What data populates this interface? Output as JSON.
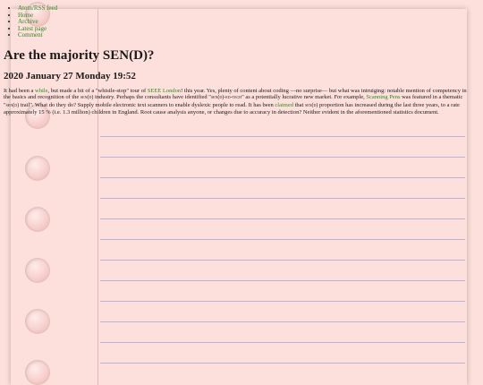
{
  "nav": [
    {
      "label": "Atom/RSS feed"
    },
    {
      "label": "Home"
    },
    {
      "label": "Archive"
    },
    {
      "label": "Latest page"
    },
    {
      "label": "Comment"
    }
  ],
  "post": {
    "title": "Are the majority SEN(D)?",
    "date": "2020 January 27 Monday 19:52",
    "p1": "It had been a ",
    "link_while": "while",
    "p2": ", but made a bit of a \"whistle-stop\" tour of ",
    "link_london": "SEEE London",
    "p3": "! this year. Yes, plenty of content about coding —no surprise— but what was intruiging: notable mention of competency in the basics and recognition of the ",
    "sc1": "sen(d)",
    "p4": " industry. Perhaps the consultants have identified \"",
    "sc2": "sen(d)-ed-tech",
    "p5": "\" as a potentially lucrative new market. For example, ",
    "link_pens": "Scanning Pens",
    "p6": " was featured in a thematic \"",
    "sc3": "sen(d)",
    "p7": " trail\". What do they do? Supply mobile electronic text scanners to enable dyslexic people to read. It has been ",
    "link_claimed": "claimed",
    "p8": " that ",
    "sc4": "sen(d)",
    "p9": " proportion has increased during the last three years, to a rate approximately 15 % (i.e. 1.3 million) children in England. Root cause analysis anyone, or changes due to accuracy in detection? Neither evident in the aforementioned statistics document."
  }
}
